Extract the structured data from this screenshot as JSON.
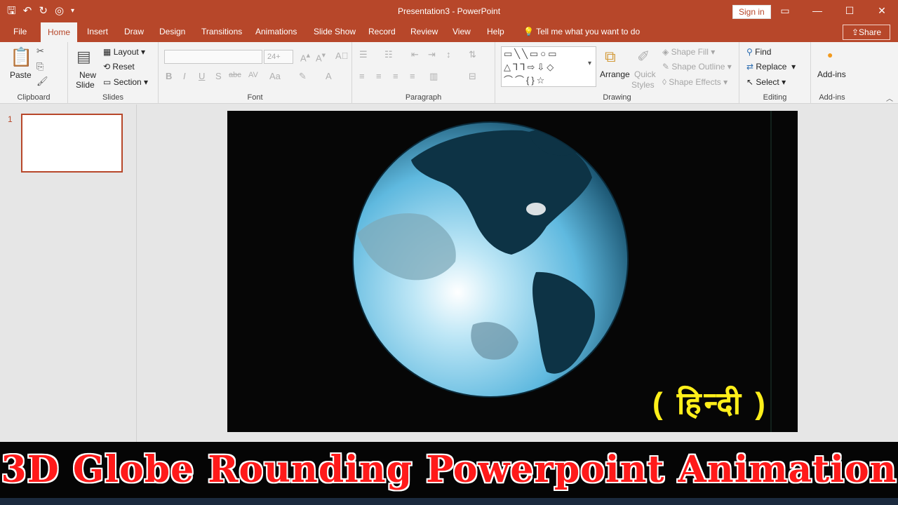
{
  "title_bar": {
    "doc_title": "Presentation3  -  PowerPoint",
    "sign_in": "Sign in",
    "qat_icons": [
      "save-icon",
      "undo-icon",
      "redo-icon",
      "present-icon",
      "customize-icon"
    ]
  },
  "tabs": {
    "file": "File",
    "home": "Home",
    "insert": "Insert",
    "draw": "Draw",
    "design": "Design",
    "transitions": "Transitions",
    "animations": "Animations",
    "slide_show": "Slide Show",
    "record": "Record",
    "review": "Review",
    "view": "View",
    "help": "Help",
    "tell_me": "Tell me what you want to do",
    "share": "Share"
  },
  "ribbon": {
    "clipboard": {
      "paste": "Paste",
      "label": "Clipboard"
    },
    "slides": {
      "new_slide_1": "New",
      "new_slide_2": "Slide",
      "layout": "Layout",
      "reset": "Reset",
      "section": "Section",
      "label": "Slides"
    },
    "font": {
      "size": "24+",
      "label": "Font",
      "buttons": [
        "B",
        "I",
        "U",
        "S",
        "abc",
        "AV",
        "Aa",
        "A"
      ]
    },
    "paragraph": {
      "label": "Paragraph"
    },
    "drawing": {
      "arrange": "Arrange",
      "quick_styles_1": "Quick",
      "quick_styles_2": "Styles",
      "shape_fill": "Shape Fill",
      "shape_outline": "Shape Outline",
      "shape_effects": "Shape Effects",
      "label": "Drawing"
    },
    "editing": {
      "find": "Find",
      "replace": "Replace",
      "select": "Select",
      "label": "Editing"
    },
    "addins": {
      "addins": "Add-ins",
      "label": "Add-ins"
    }
  },
  "slides_pane": {
    "slide_number": "1"
  },
  "slide": {
    "hindi_text": "( हिन्दी )"
  },
  "banner": {
    "title": "3D Globe Rounding Powerpoint Animation"
  },
  "colors": {
    "accent": "#b7472a",
    "slide_bg": "#060606",
    "globe": "#6fc6e6",
    "banner_text": "#ff1a1a",
    "hindi_text": "#ffef1a"
  }
}
